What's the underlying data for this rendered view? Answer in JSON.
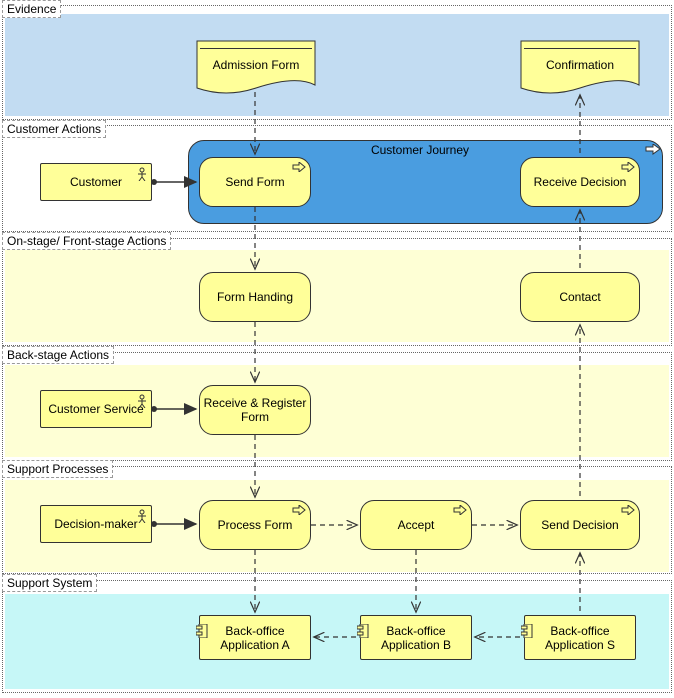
{
  "lanes": {
    "evidence": "Evidence",
    "customer_actions": "Customer Actions",
    "front_stage": "On-stage/ Front-stage Actions",
    "back_stage": "Back-stage Actions",
    "support_processes": "Support Processes",
    "support_system": "Support System"
  },
  "journey_label": "Customer Journey",
  "nodes": {
    "admission_form": "Admission Form",
    "confirmation": "Confirmation",
    "customer": "Customer",
    "send_form": "Send Form",
    "receive_decision": "Receive Decision",
    "form_handing": "Form Handing",
    "contact": "Contact",
    "customer_service": "Customer Service",
    "receive_register": "Receive & Register Form",
    "decision_maker": "Decision-maker",
    "process_form": "Process Form",
    "accept": "Accept",
    "send_decision": "Send Decision",
    "app_a": "Back-office Application A",
    "app_b": "Back-office Application B",
    "app_s": "Back-office Application S"
  }
}
